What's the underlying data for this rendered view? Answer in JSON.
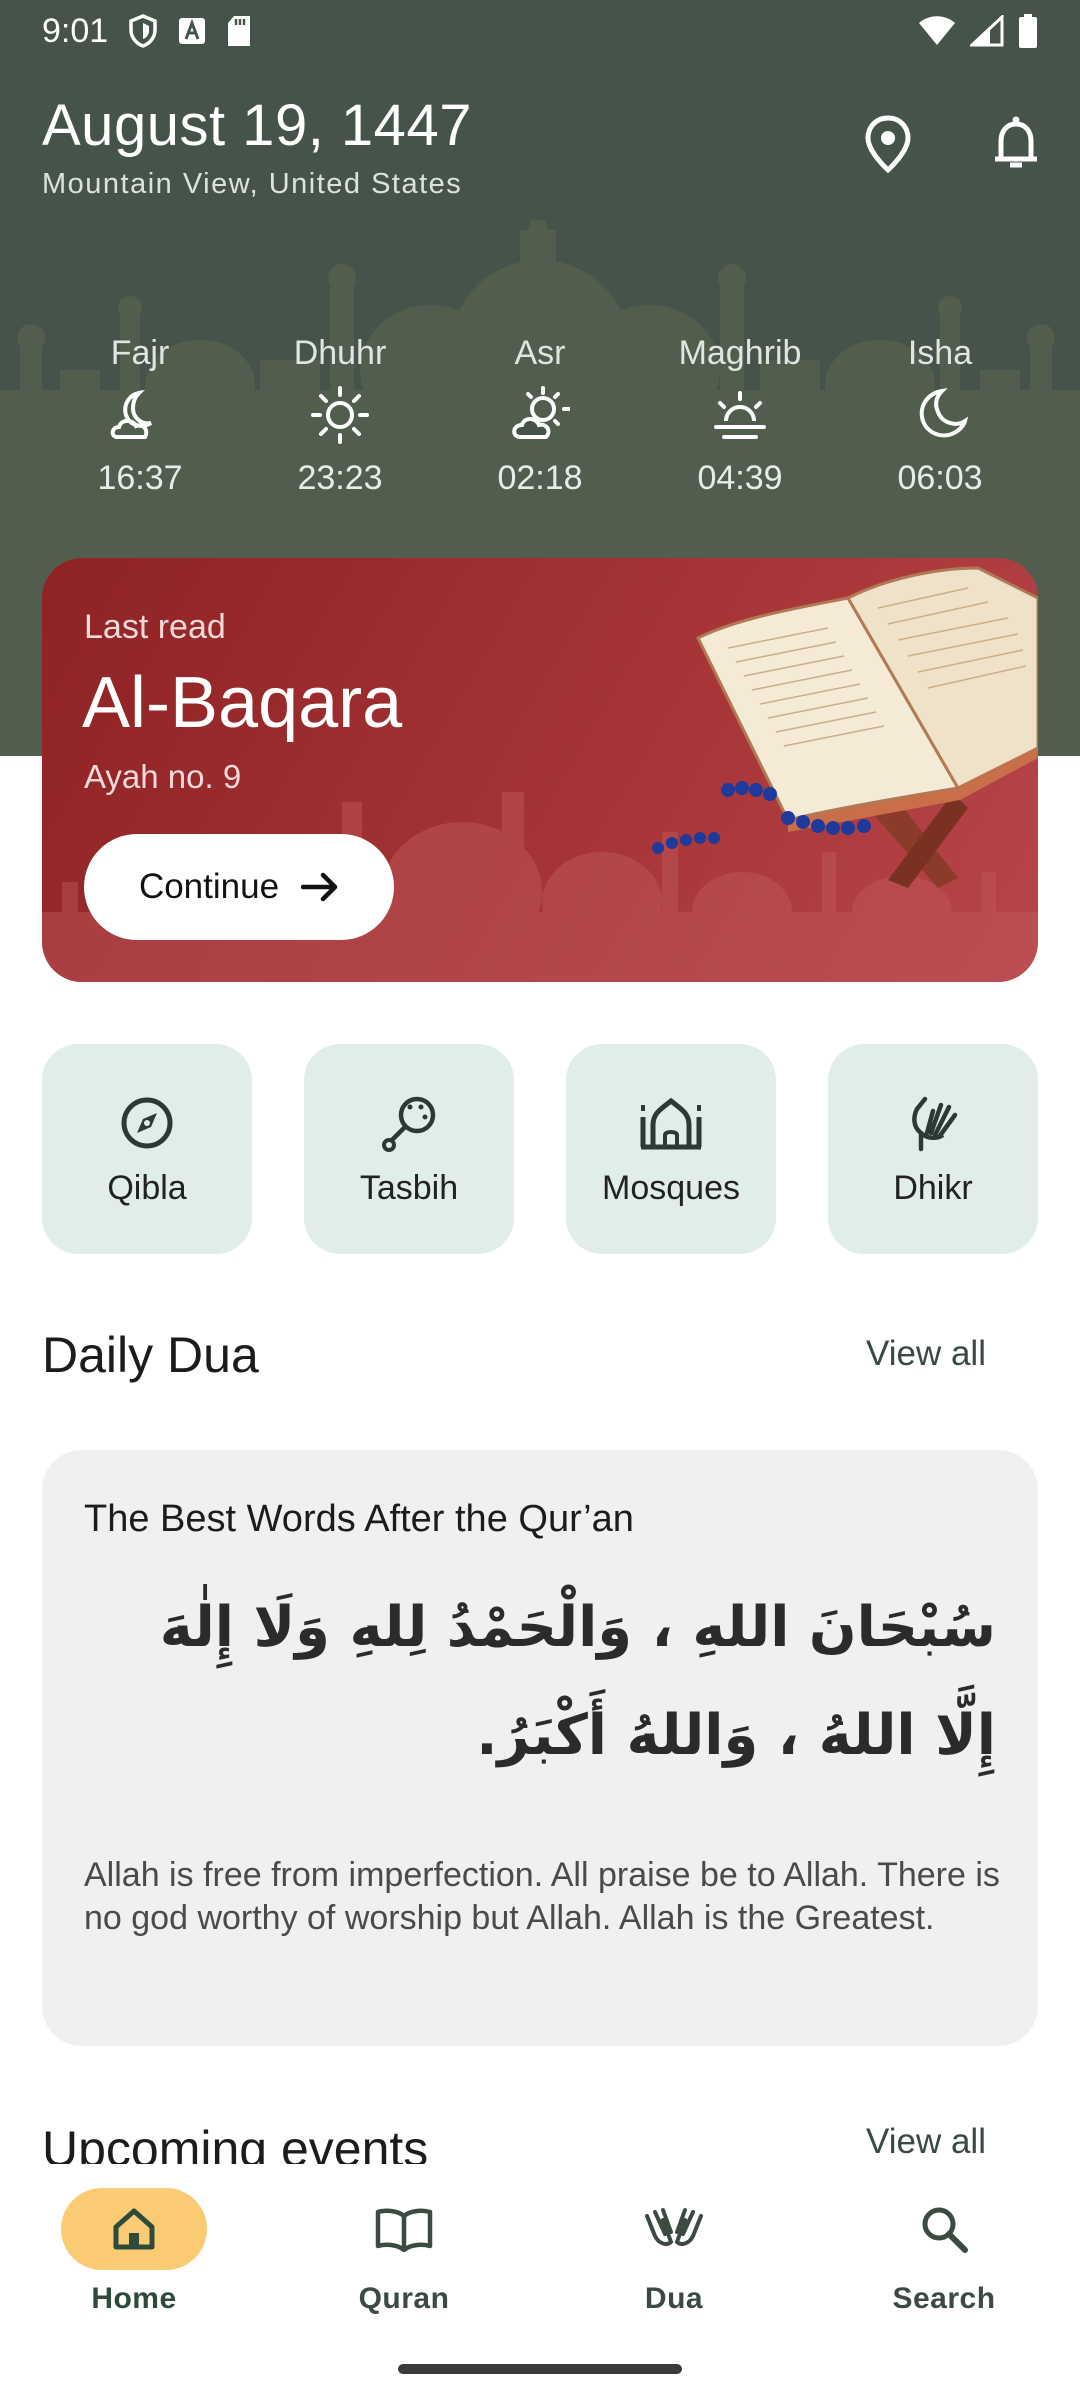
{
  "status_bar": {
    "time": "9:01"
  },
  "header": {
    "date": "August 19, 1447",
    "location": "Mountain View, United States"
  },
  "prayers": [
    {
      "name": "Fajr",
      "time": "16:37",
      "icon": "moon-cloud-icon"
    },
    {
      "name": "Dhuhr",
      "time": "23:23",
      "icon": "sun-icon"
    },
    {
      "name": "Asr",
      "time": "02:18",
      "icon": "sun-cloud-icon"
    },
    {
      "name": "Maghrib",
      "time": "04:39",
      "icon": "sunset-icon"
    },
    {
      "name": "Isha",
      "time": "06:03",
      "icon": "moon-icon"
    }
  ],
  "last_read": {
    "label": "Last read",
    "surah": "Al-Baqara",
    "ayah": "Ayah no. 9",
    "continue_label": "Continue"
  },
  "quick_actions": [
    {
      "label": "Qibla",
      "icon": "compass-icon"
    },
    {
      "label": "Tasbih",
      "icon": "tasbih-icon"
    },
    {
      "label": "Mosques",
      "icon": "mosque-icon"
    },
    {
      "label": "Dhikr",
      "icon": "hands-icon"
    }
  ],
  "daily_dua": {
    "section_title": "Daily Dua",
    "view_all": "View all",
    "title": "The Best Words After the Qur’an",
    "arabic": "سُبْحَانَ اللهِ ، وَالْحَمْدُ لِلهِ وَلَا إِلٰهَ إِلَّا اللهُ ، وَاللهُ أَكْبَرُ.",
    "translation": "Allah is free from imperfection. All praise be to Allah. There is no god worthy of worship but Allah. Allah is the Greatest."
  },
  "upcoming": {
    "section_title": "Upcoming events",
    "view_all": "View all"
  },
  "bottom_nav": [
    {
      "label": "Home",
      "icon": "home-icon",
      "active": true
    },
    {
      "label": "Quran",
      "icon": "book-icon",
      "active": false
    },
    {
      "label": "Dua",
      "icon": "praying-hands-icon",
      "active": false
    },
    {
      "label": "Search",
      "icon": "search-icon",
      "active": false
    }
  ],
  "colors": {
    "header_bg": "#46534a",
    "card_red": "#a63436",
    "quick_action_bg": "#e1ede9",
    "nav_active_pill": "#fbcb73"
  }
}
